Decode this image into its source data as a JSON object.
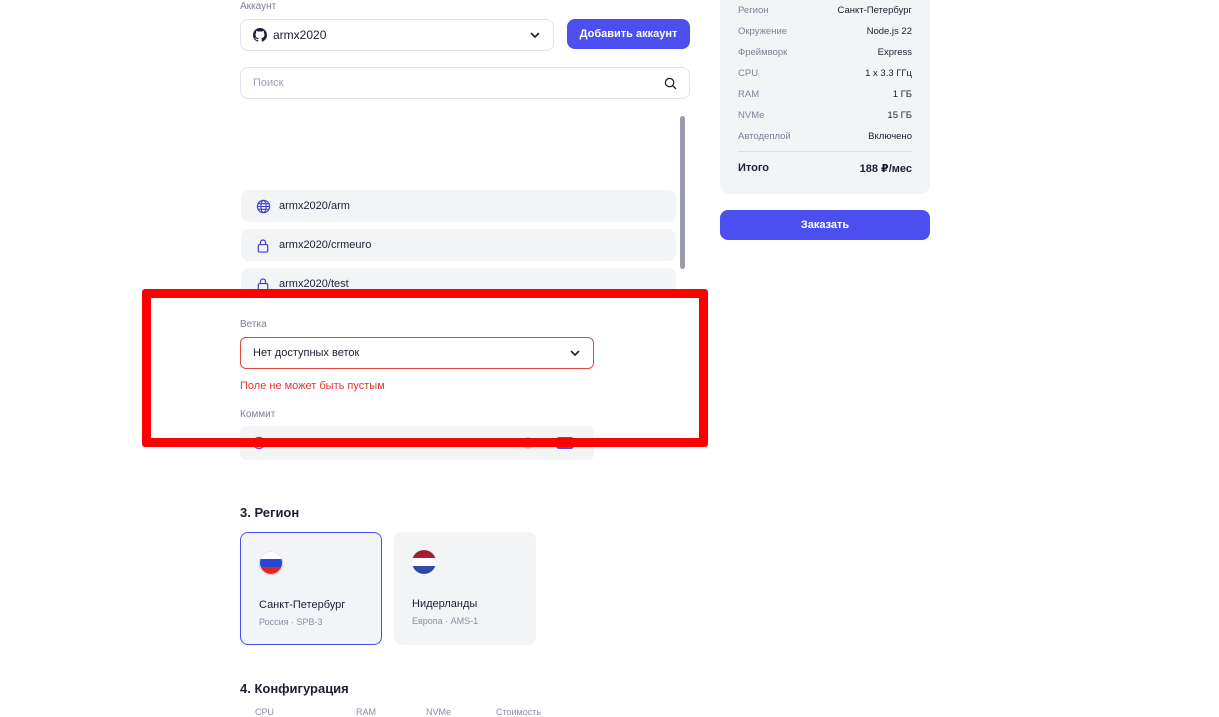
{
  "account": {
    "label": "Аккаунт",
    "selected": "armx2020",
    "add_button": "Добавить аккаунт"
  },
  "search": {
    "placeholder": "Поиск"
  },
  "repos": [
    {
      "name": "armx2020/arm",
      "icon": "globe-icon"
    },
    {
      "name": "armx2020/crmeuro",
      "icon": "lock-icon"
    },
    {
      "name": "armx2020/test",
      "icon": "lock-icon"
    }
  ],
  "branch": {
    "label": "Ветка",
    "value": "Нет доступных веток",
    "error": "Поле не может быть пустым"
  },
  "commit": {
    "label": "Коммит"
  },
  "region": {
    "title": "3. Регион",
    "cards": [
      {
        "name": "Санкт-Петербург",
        "sub": "Россия · SPB-3",
        "selected": true
      },
      {
        "name": "Нидерланды",
        "sub": "Европа · AMS-1",
        "selected": false
      }
    ]
  },
  "config": {
    "title": "4. Конфигурация",
    "columns": [
      "CPU",
      "RAM",
      "NVMe",
      "Стоимость"
    ]
  },
  "summary": {
    "rows": [
      {
        "k": "Регион",
        "v": "Санкт-Петербург"
      },
      {
        "k": "Окружение",
        "v": "Node.js 22"
      },
      {
        "k": "Фреймворк",
        "v": "Express"
      },
      {
        "k": "CPU",
        "v": "1 x 3.3 ГГц"
      },
      {
        "k": "RAM",
        "v": "1 ГБ"
      },
      {
        "k": "NVMe",
        "v": "15 ГБ"
      },
      {
        "k": "Автодеплой",
        "v": "Включено"
      }
    ],
    "total_label": "Итого",
    "total_value": "188 ₽/мес",
    "order_button": "Заказать"
  },
  "colors": {
    "accent": "#4b4ff0",
    "error": "#e2372b",
    "highlight": "#ff0000"
  }
}
